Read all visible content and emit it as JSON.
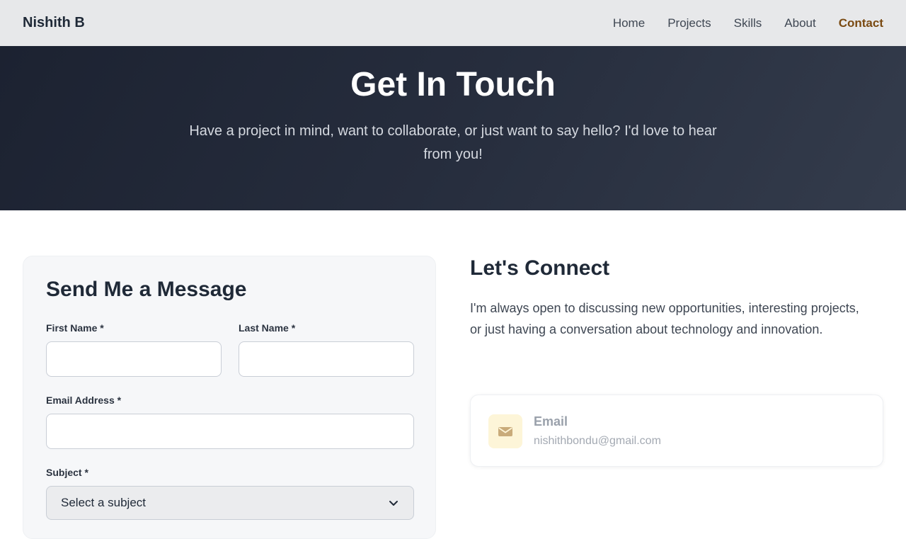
{
  "nav": {
    "brand": "Nishith B",
    "links": [
      {
        "label": "Home",
        "active": false
      },
      {
        "label": "Projects",
        "active": false
      },
      {
        "label": "Skills",
        "active": false
      },
      {
        "label": "About",
        "active": false
      },
      {
        "label": "Contact",
        "active": true
      }
    ]
  },
  "hero": {
    "title": "Get In Touch",
    "subtitle": "Have a project in mind, want to collaborate, or just want to say hello? I'd love to hear from you!"
  },
  "form": {
    "title": "Send Me a Message",
    "first_name": {
      "label": "First Name *",
      "value": "",
      "placeholder": ""
    },
    "last_name": {
      "label": "Last Name *",
      "value": "",
      "placeholder": ""
    },
    "email": {
      "label": "Email Address *",
      "value": "",
      "placeholder": ""
    },
    "subject": {
      "label": "Subject *",
      "selected": "Select a subject"
    }
  },
  "connect": {
    "title": "Let's Connect",
    "text": "I'm always open to discussing new opportunities, interesting projects, or just having a conversation about technology and innovation.",
    "email_card": {
      "icon": "envelope-icon",
      "label": "Email",
      "value": "nishithbondu@gmail.com"
    }
  },
  "colors": {
    "accent": "#7a4a12",
    "hero_bg": "#1c2231",
    "card_bg": "#f6f7f9",
    "email_icon_bg": "#fdf5d8"
  }
}
